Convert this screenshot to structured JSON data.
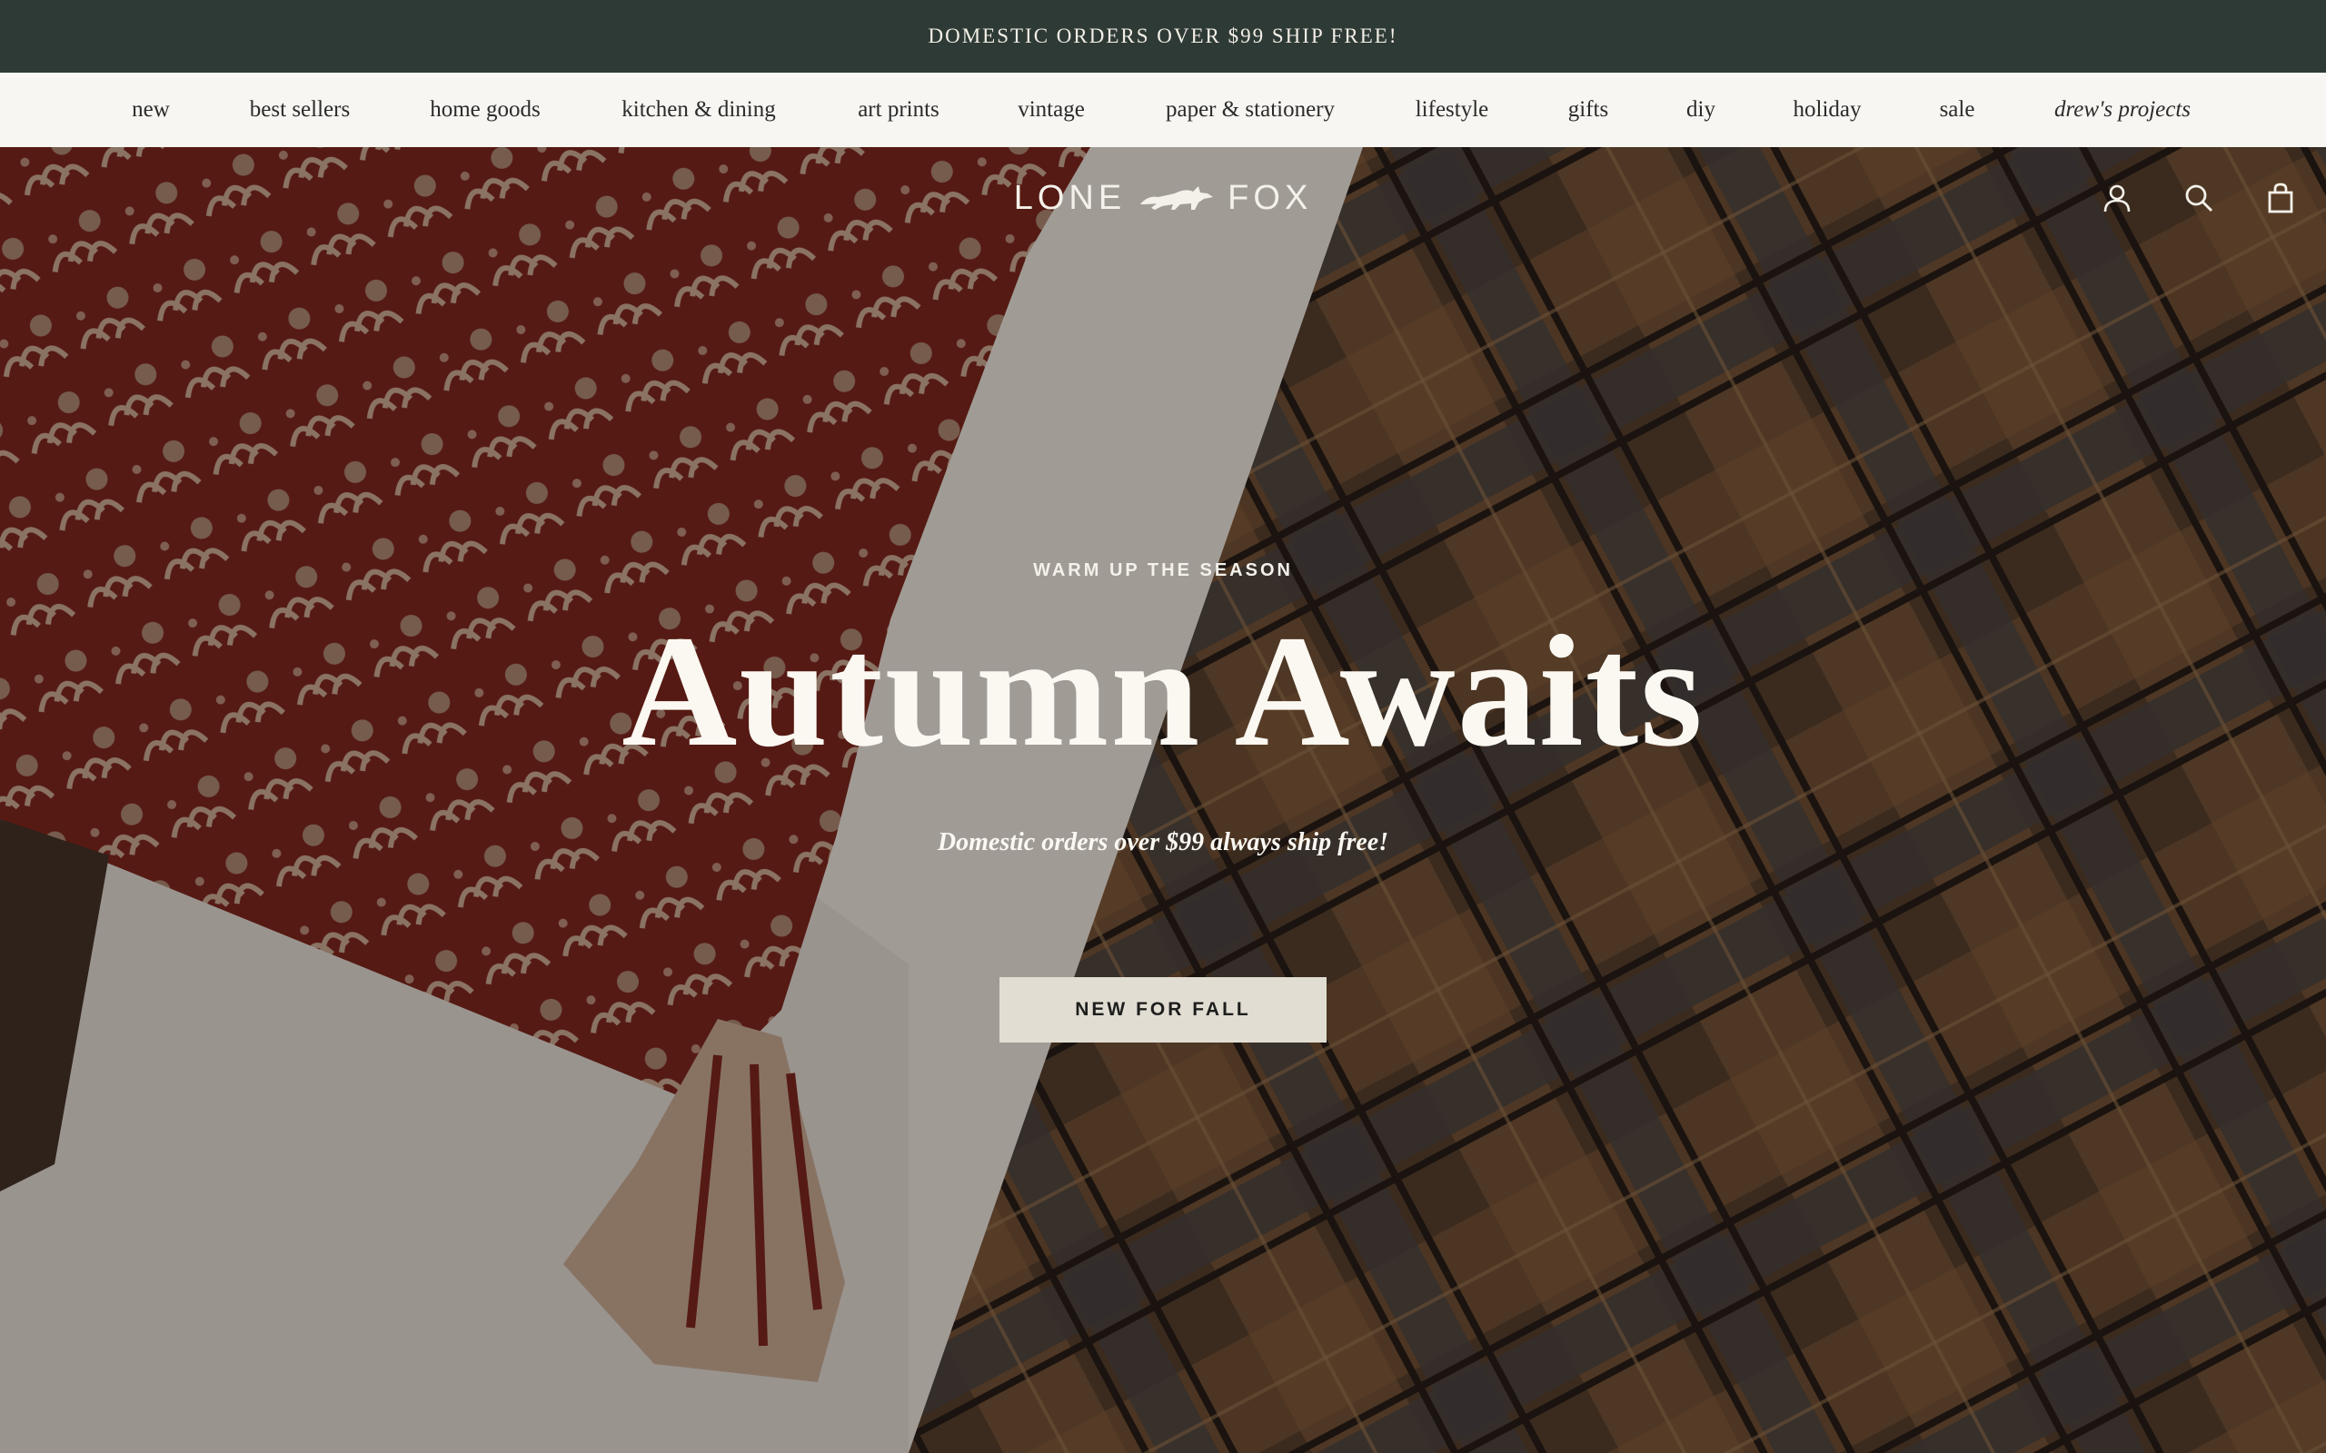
{
  "announcement": {
    "text": "DOMESTIC ORDERS OVER $99 SHIP FREE!"
  },
  "nav": {
    "items": [
      {
        "label": "new"
      },
      {
        "label": "best sellers"
      },
      {
        "label": "home goods"
      },
      {
        "label": "kitchen & dining"
      },
      {
        "label": "art prints"
      },
      {
        "label": "vintage"
      },
      {
        "label": "paper & stationery"
      },
      {
        "label": "lifestyle"
      },
      {
        "label": "gifts"
      },
      {
        "label": "diy"
      },
      {
        "label": "holiday"
      },
      {
        "label": "sale"
      },
      {
        "label": "drew's projects"
      }
    ]
  },
  "header": {
    "logo_left": "LONE",
    "logo_right": "FOX",
    "icons": [
      "account-icon",
      "search-icon",
      "cart-icon"
    ]
  },
  "hero": {
    "eyebrow": "WARM UP THE SEASON",
    "title": "Autumn Awaits",
    "subtitle": "Domestic orders over $99 always ship free!",
    "cta_label": "NEW FOR FALL"
  },
  "colors": {
    "announcement_bg": "#2e3a36",
    "nav_bg": "#f7f6f2",
    "cta_bg": "#e1ddd2",
    "hero_text": "#fbf8f2"
  }
}
